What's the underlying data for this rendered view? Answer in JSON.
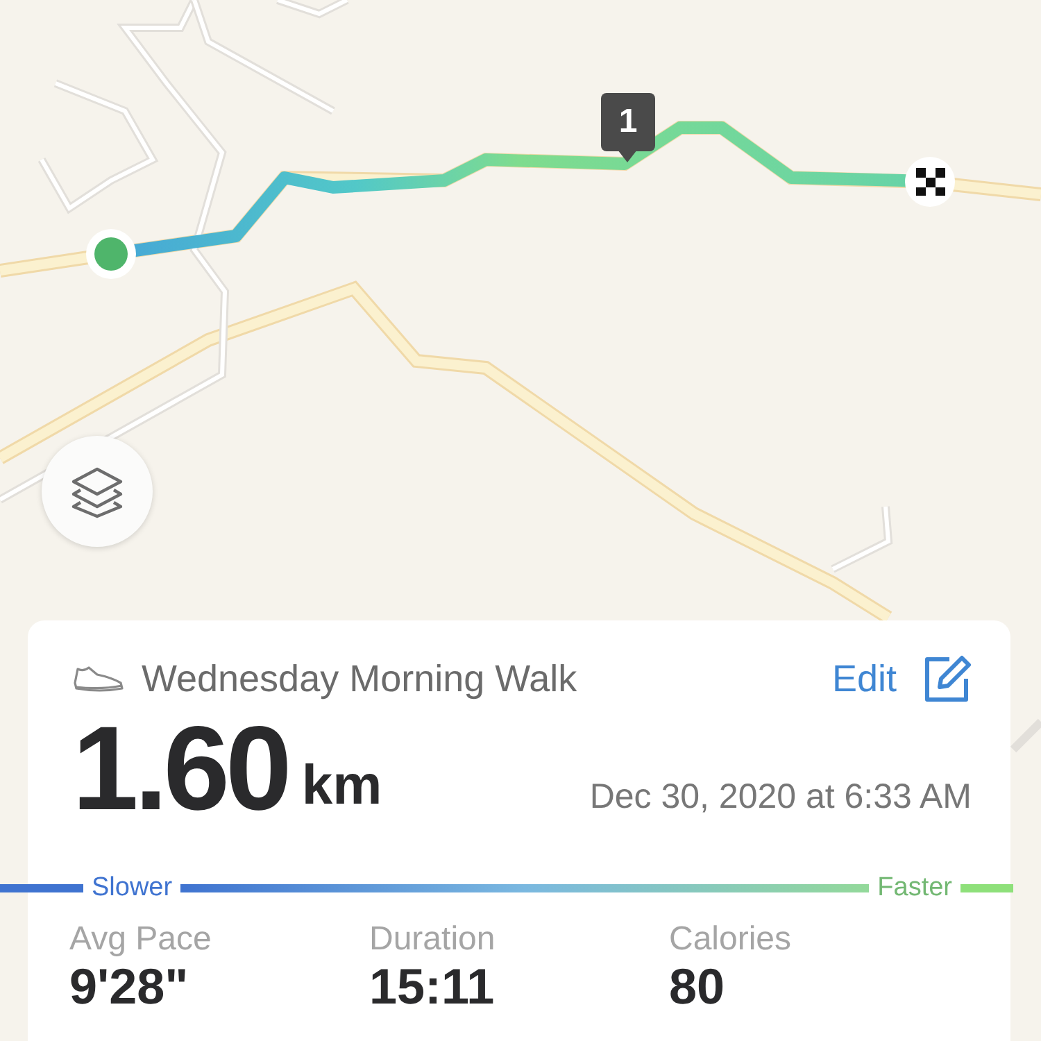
{
  "map": {
    "split_markers": [
      {
        "label": "1"
      }
    ]
  },
  "activity": {
    "title": "Wednesday Morning Walk",
    "edit_label": "Edit",
    "distance": "1.60",
    "unit": "km",
    "date": "Dec 30, 2020 at 6:33 AM"
  },
  "pace_legend": {
    "slower": "Slower",
    "faster": "Faster"
  },
  "stats": [
    {
      "label": "Avg Pace",
      "value": "9'28\""
    },
    {
      "label": "Duration",
      "value": "15:11"
    },
    {
      "label": "Calories",
      "value": "80"
    }
  ]
}
